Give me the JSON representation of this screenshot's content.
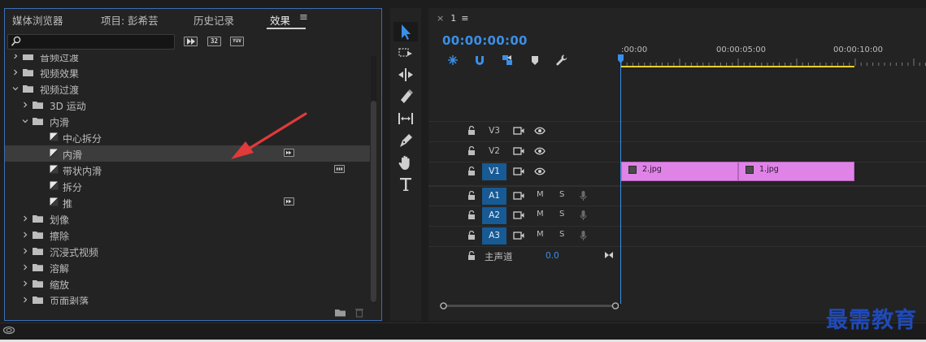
{
  "effects_panel": {
    "tabs": [
      {
        "label": "媒体浏览器"
      },
      {
        "label": "项目: 彭希芸"
      },
      {
        "label": "历史记录"
      },
      {
        "label": "效果"
      }
    ],
    "menu_icon": "≡",
    "search": {
      "value": "",
      "placeholder": ""
    },
    "filter_badges": [
      "32",
      "YUV"
    ],
    "tree": [
      {
        "label": "音频过渡",
        "level": 0,
        "type": "folder",
        "expanded": false
      },
      {
        "label": "视频效果",
        "level": 0,
        "type": "folder",
        "expanded": false
      },
      {
        "label": "视频过渡",
        "level": 0,
        "type": "folder",
        "expanded": true
      },
      {
        "label": "3D 运动",
        "level": 1,
        "type": "folder",
        "expanded": false
      },
      {
        "label": "内滑",
        "level": 1,
        "type": "folder",
        "expanded": true
      },
      {
        "label": "中心拆分",
        "level": 2,
        "type": "preset"
      },
      {
        "label": "内滑",
        "level": 2,
        "type": "preset",
        "selected": true,
        "badge": "accel"
      },
      {
        "label": "带状内滑",
        "level": 2,
        "type": "preset",
        "badge": "yuv"
      },
      {
        "label": "拆分",
        "level": 2,
        "type": "preset"
      },
      {
        "label": "推",
        "level": 2,
        "type": "preset",
        "badge": "accel"
      },
      {
        "label": "划像",
        "level": 1,
        "type": "folder",
        "expanded": false
      },
      {
        "label": "擦除",
        "level": 1,
        "type": "folder",
        "expanded": false
      },
      {
        "label": "沉浸式视频",
        "level": 1,
        "type": "folder",
        "expanded": false
      },
      {
        "label": "溶解",
        "level": 1,
        "type": "folder",
        "expanded": false
      },
      {
        "label": "缩放",
        "level": 1,
        "type": "folder",
        "expanded": false
      },
      {
        "label": "页面剥落",
        "level": 1,
        "type": "folder",
        "expanded": false
      }
    ]
  },
  "timeline": {
    "sequence_tab": {
      "close": "×",
      "name": "1",
      "menu": "≡"
    },
    "timecode": "00:00:00:00",
    "ruler_labels": [
      ":00:00",
      "00:00:05:00",
      "00:00:10:00"
    ],
    "video_tracks": [
      {
        "name": "V3",
        "targeted": false
      },
      {
        "name": "V2",
        "targeted": false
      },
      {
        "name": "V1",
        "targeted": true
      }
    ],
    "audio_tracks": [
      {
        "name": "A1",
        "targeted": true,
        "m": "M",
        "s": "S"
      },
      {
        "name": "A2",
        "targeted": true,
        "m": "M",
        "s": "S"
      },
      {
        "name": "A3",
        "targeted": true,
        "m": "M",
        "s": "S"
      }
    ],
    "master": {
      "label": "主声道",
      "value": "0.0"
    },
    "clips": [
      {
        "name": "2.jpg"
      },
      {
        "name": "1.jpg"
      }
    ]
  },
  "watermark": "最需教育",
  "colors": {
    "accent_blue": "#3b8fe8",
    "clip_pink": "#e083e6",
    "ruler_yellow": "#e6d02c",
    "target_blue": "#175a94",
    "arrow_red": "#e03a3a",
    "watermark_blue": "#1f4ab8"
  }
}
